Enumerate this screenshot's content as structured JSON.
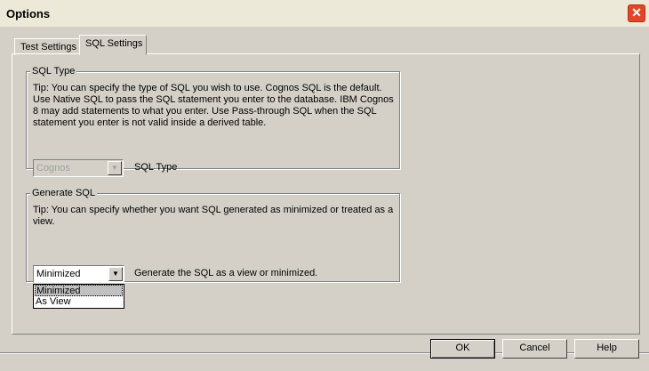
{
  "window": {
    "title": "Options",
    "close_glyph": "✕"
  },
  "tabs": [
    {
      "label": "Test Settings",
      "selected": false
    },
    {
      "label": "SQL Settings",
      "selected": true
    }
  ],
  "sql_type": {
    "group_label": "SQL Type",
    "tip": "Tip: You can specify the type of SQL you wish to use. Cognos SQL is the default. Use Native SQL to pass the SQL statement you enter to the database. IBM Cognos 8 may add statements to what you enter. Use Pass-through SQL when the SQL statement you enter is not valid inside a derived table.",
    "combo_value": "Cognos",
    "combo_enabled": false,
    "label": "SQL Type"
  },
  "generate_sql": {
    "group_label": "Generate SQL",
    "tip": "Tip: You can specify whether you want SQL generated as minimized or treated as a view.",
    "combo_value": "Minimized",
    "label": "Generate the SQL as a view or minimized.",
    "options": [
      "Minimized",
      "As View"
    ],
    "highlighted_option": "Minimized"
  },
  "buttons": {
    "ok": "OK",
    "cancel": "Cancel",
    "help": "Help"
  },
  "colors": {
    "dialog_bg": "#d4d0c8",
    "close_red": "#e0472a",
    "selection": "#c0c0c0"
  }
}
